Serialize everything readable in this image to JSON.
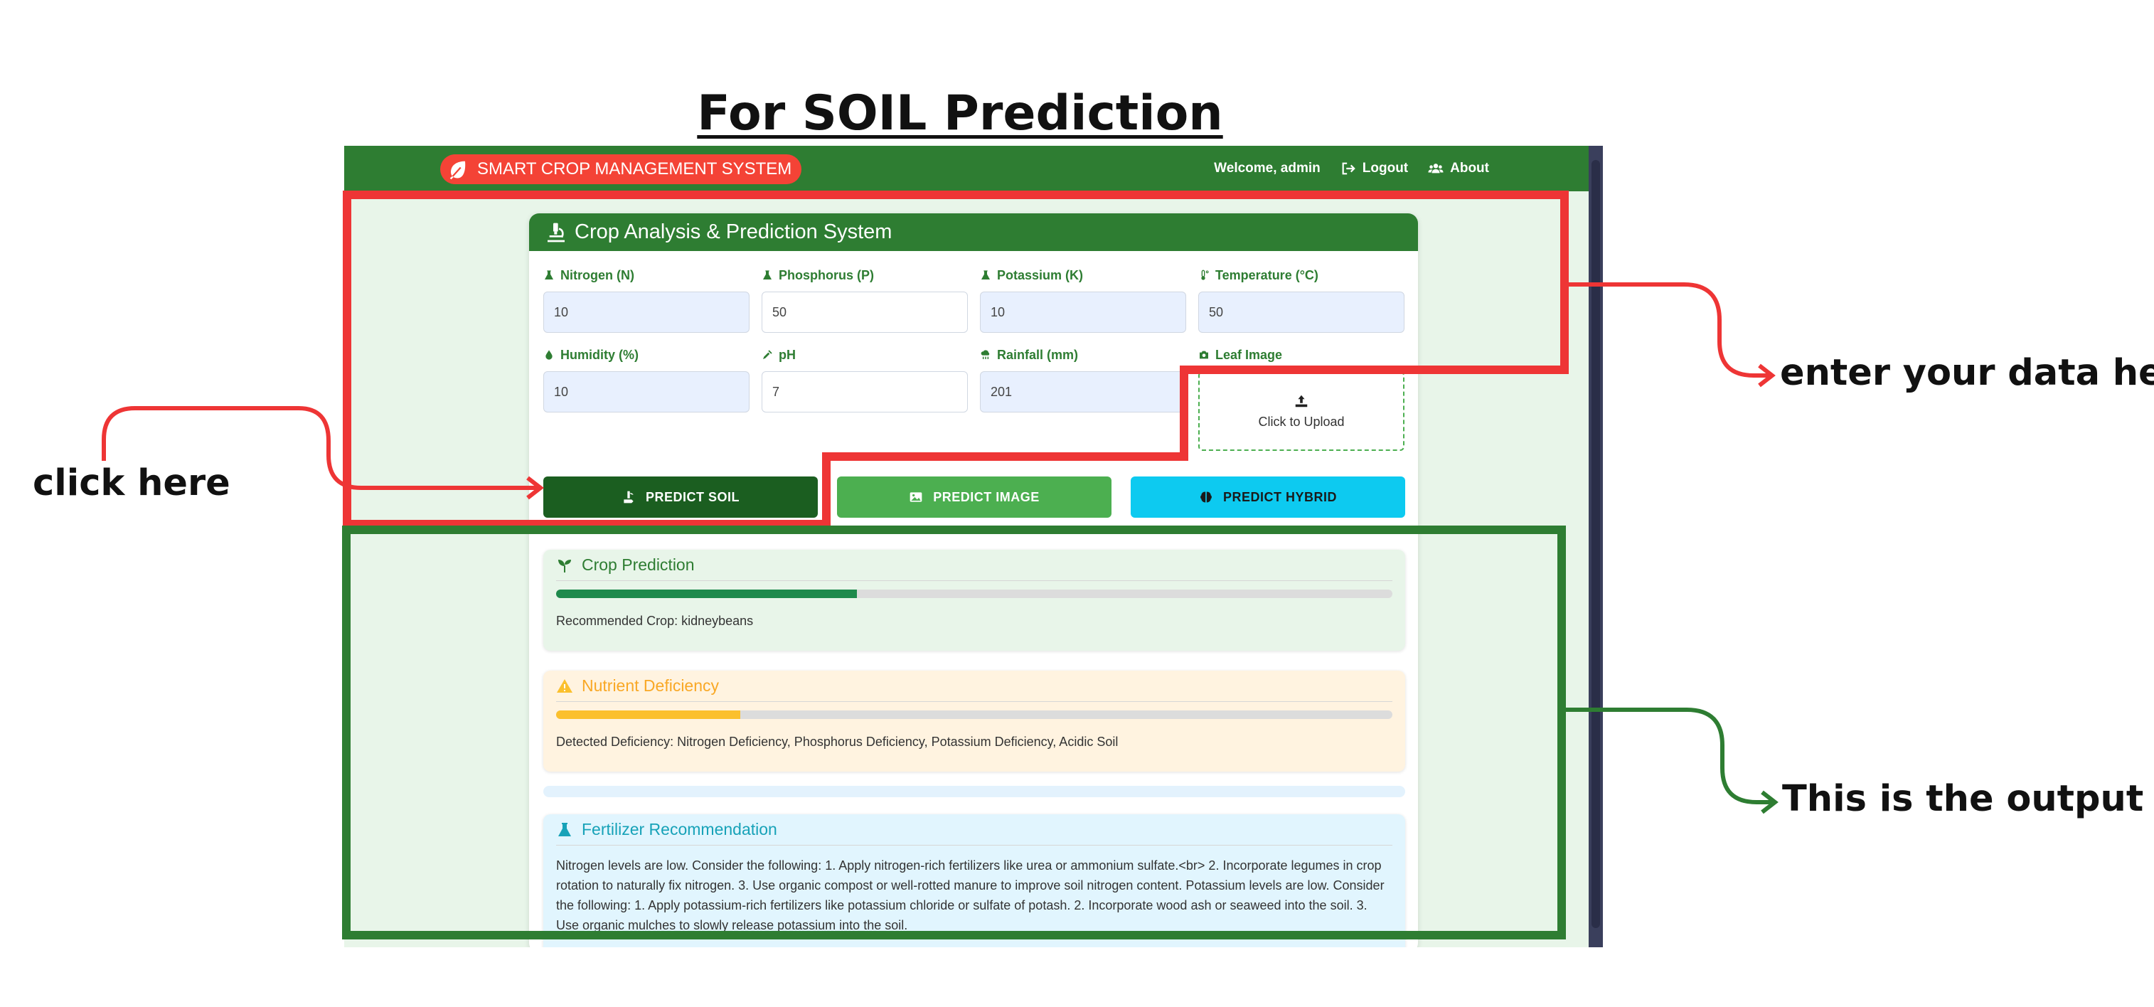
{
  "heading": "For SOIL Prediction",
  "navbar": {
    "brand": "SMART CROP MANAGEMENT SYSTEM",
    "welcome": "Welcome, admin",
    "logout": "Logout",
    "about": "About"
  },
  "card": {
    "title": "Crop Analysis & Prediction System",
    "fields": {
      "nitrogen": {
        "label": "Nitrogen (N)",
        "value": "10"
      },
      "phosphorus": {
        "label": "Phosphorus (P)",
        "value": "50"
      },
      "potassium": {
        "label": "Potassium (K)",
        "value": "10"
      },
      "temperature": {
        "label": "Temperature (°C)",
        "value": "50"
      },
      "humidity": {
        "label": "Humidity (%)",
        "value": "10"
      },
      "ph": {
        "label": "pH",
        "value": "7"
      },
      "rainfall": {
        "label": "Rainfall (mm)",
        "value": "201"
      },
      "leaf": {
        "label": "Leaf Image",
        "upload": "Click to Upload"
      }
    },
    "buttons": {
      "soil": "PREDICT SOIL",
      "image": "PREDICT IMAGE",
      "hybrid": "PREDICT HYBRID"
    }
  },
  "results": {
    "crop": {
      "title": "Crop Prediction",
      "progress": 0.36,
      "text": "Recommended Crop: kidneybeans"
    },
    "nutrient": {
      "title": "Nutrient Deficiency",
      "progress": 0.22,
      "text": "Detected Deficiency: Nitrogen Deficiency, Phosphorus Deficiency, Potassium Deficiency, Acidic Soil"
    },
    "fertilizer": {
      "title": "Fertilizer Recommendation",
      "text": "Nitrogen levels are low. Consider the following: 1. Apply nitrogen-rich fertilizers like urea or ammonium sulfate.<br> 2. Incorporate legumes in crop rotation to naturally fix nitrogen. 3. Use organic compost or well-rotted manure to improve soil nitrogen content. Potassium levels are low. Consider the following: 1. Apply potassium-rich fertilizers like potassium chloride or sulfate of potash. 2. Incorporate wood ash or seaweed into the soil. 3. Use organic mulches to slowly release potassium into the soil."
    }
  },
  "annotations": {
    "click": "click here",
    "input": "enter your data here",
    "output": "This is the output"
  },
  "colors": {
    "primary_green": "#2e7d32",
    "annotation_red": "#ee3535",
    "annotation_green": "#2e7d32",
    "hybrid_cyan": "#0dcaf0"
  }
}
